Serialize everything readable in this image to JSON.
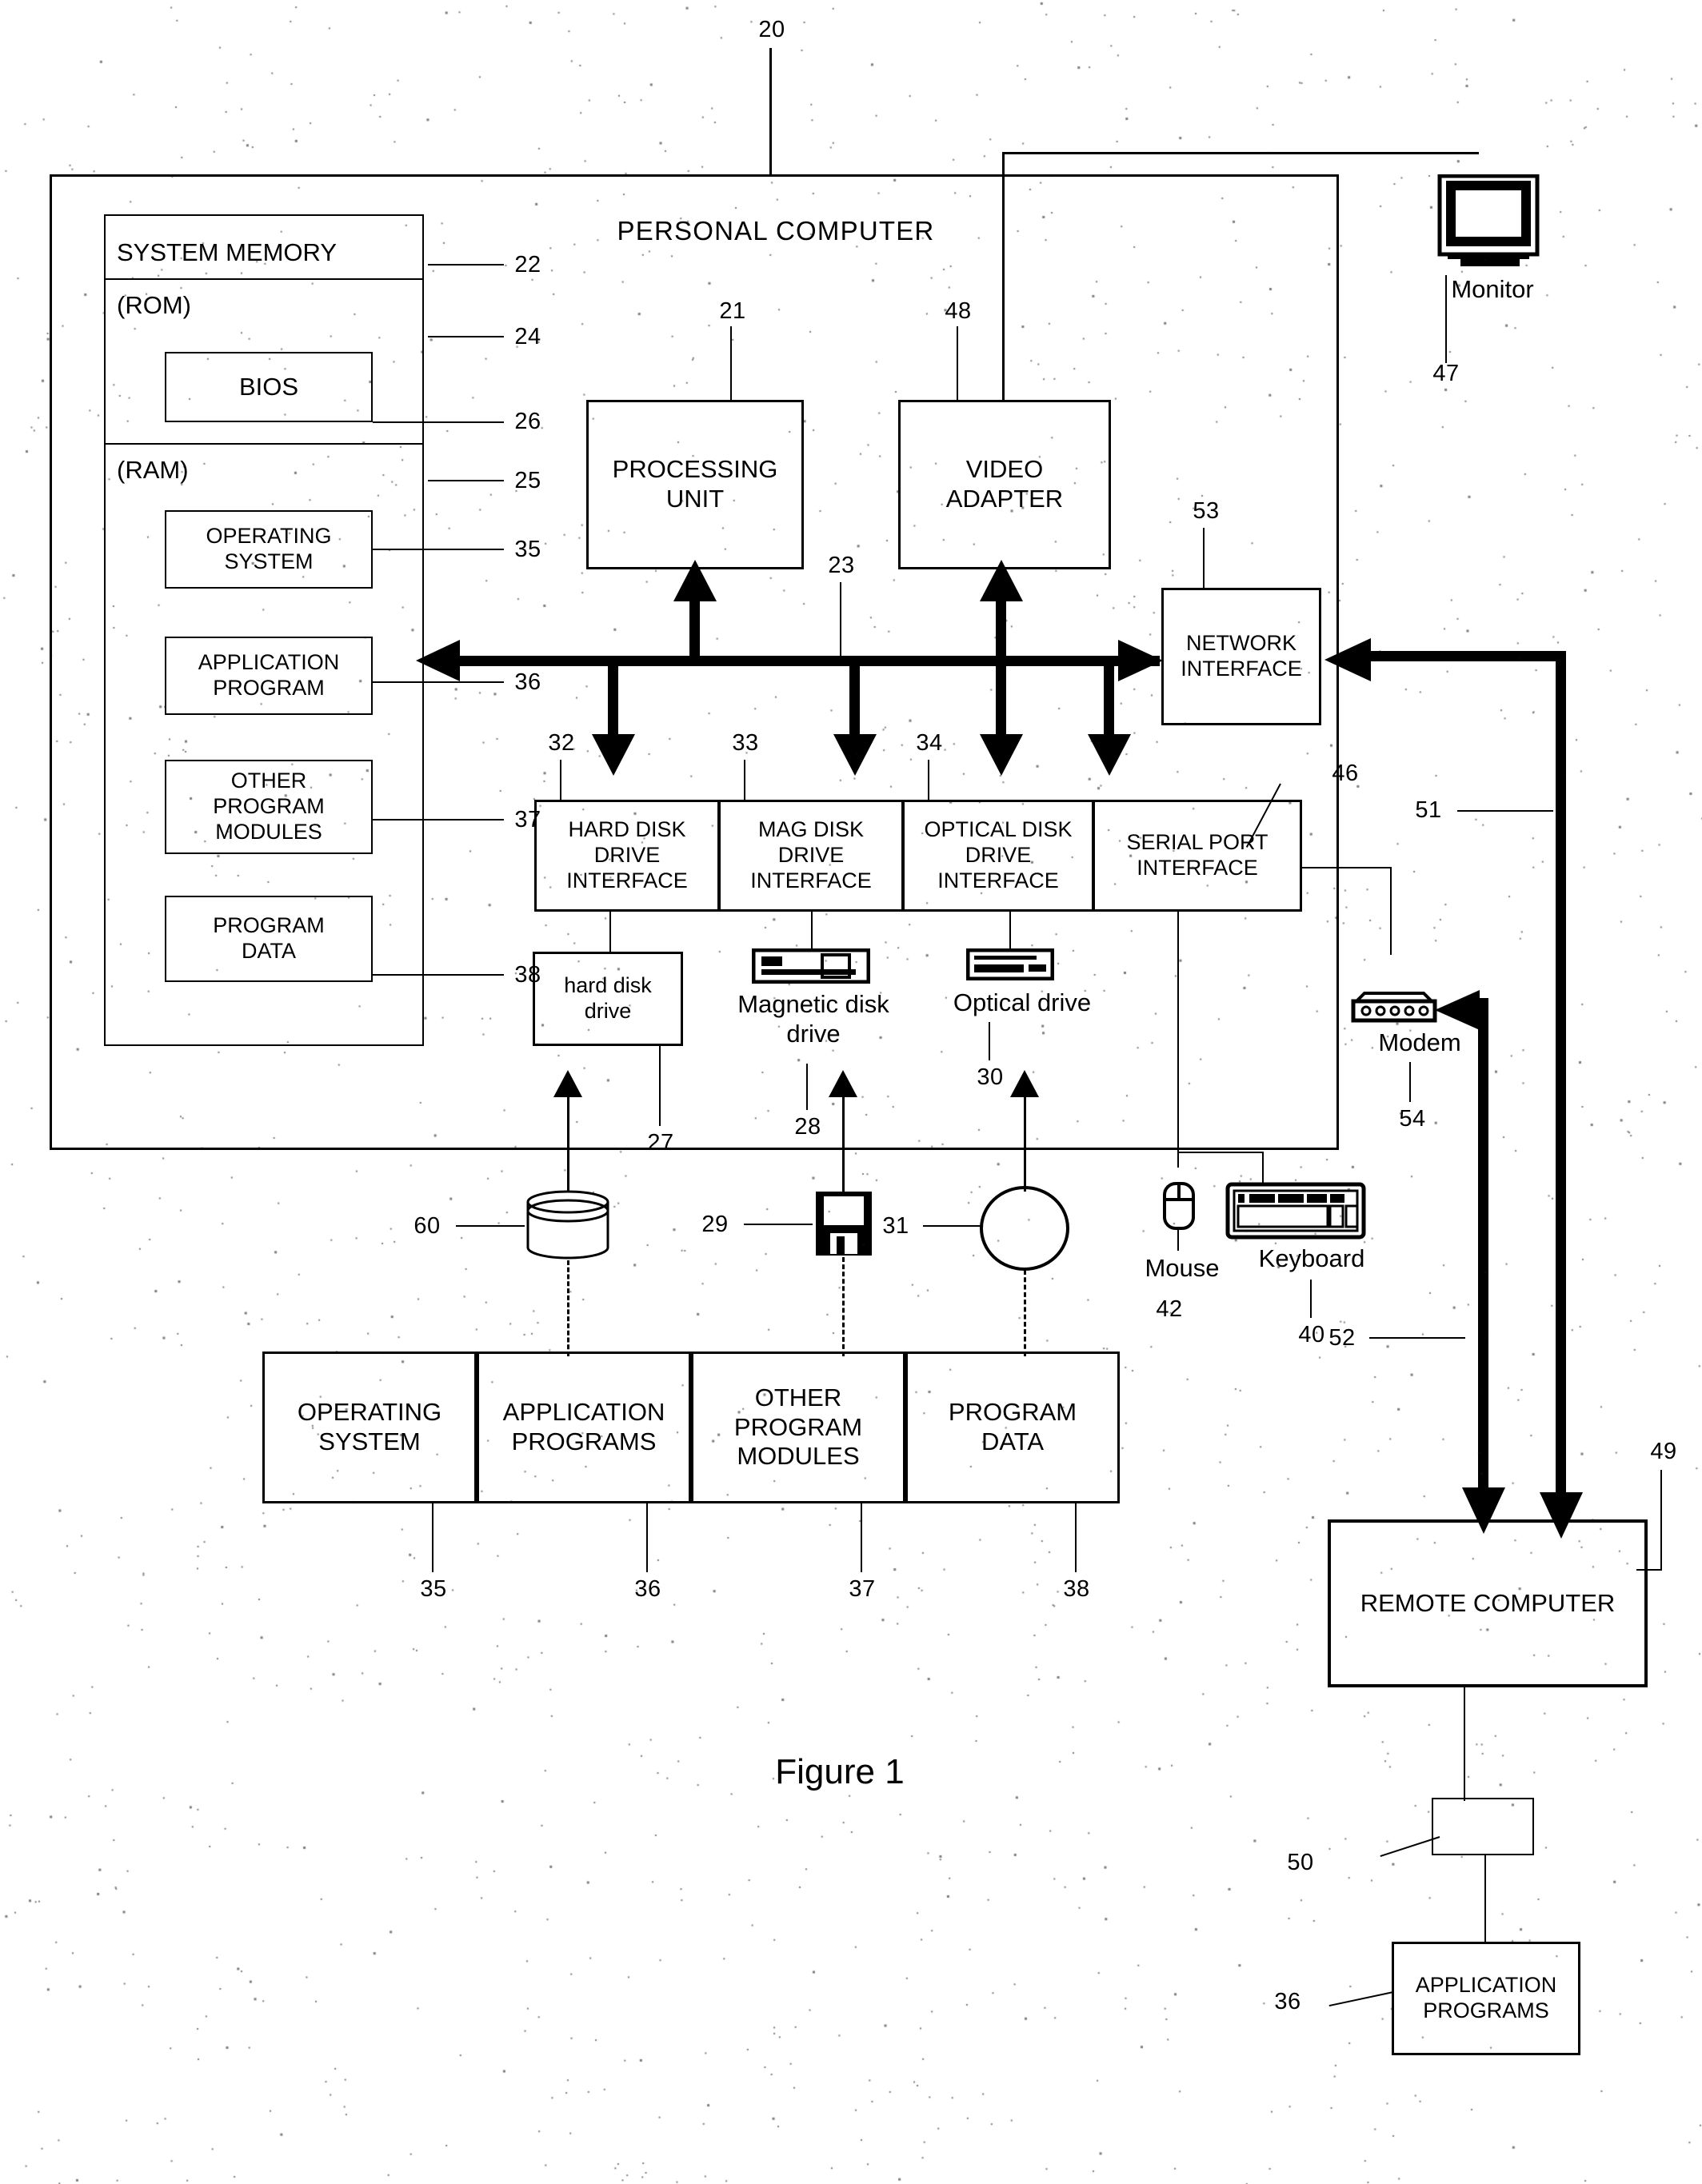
{
  "figure": {
    "caption": "Figure 1",
    "top_reference": "20",
    "system_title": "PERSONAL COMPUTER"
  },
  "system_memory": {
    "title": "SYSTEM MEMORY",
    "ref": "22",
    "rom": {
      "label": "(ROM)",
      "ref": "24",
      "bios": {
        "label": "BIOS",
        "ref": "26"
      }
    },
    "ram": {
      "label": "(RAM)",
      "ref": "25",
      "blocks": [
        {
          "label": "OPERATING\nSYSTEM",
          "ref": "35"
        },
        {
          "label": "APPLICATION\nPROGRAM",
          "ref": "36"
        },
        {
          "label": "OTHER\nPROGRAM\nMODULES",
          "ref": "37"
        },
        {
          "label": "PROGRAM\nDATA",
          "ref": "38"
        }
      ]
    }
  },
  "core": {
    "processing_unit": {
      "label": "PROCESSING\nUNIT",
      "ref": "21"
    },
    "video_adapter": {
      "label": "VIDEO\nADAPTER",
      "ref": "48"
    },
    "network_interface": {
      "label": "NETWORK\nINTERFACE",
      "ref": "53"
    },
    "bus": {
      "ref": "23"
    }
  },
  "interfaces": [
    {
      "label": "HARD DISK\nDRIVE\nINTERFACE",
      "ref": "32"
    },
    {
      "label": "MAG DISK\nDRIVE\nINTERFACE",
      "ref": "33"
    },
    {
      "label": "OPTICAL DISK\nDRIVE\nINTERFACE",
      "ref": "34"
    },
    {
      "label": "SERIAL PORT\nINTERFACE",
      "ref": "46"
    }
  ],
  "drives": {
    "hard_disk_drive": {
      "label": "hard disk\ndrive",
      "ref": "27"
    },
    "magnetic_disk_drive": {
      "label": "Magnetic disk\ndrive",
      "ref": "28"
    },
    "optical_drive": {
      "label": "Optical drive",
      "ref": "30"
    }
  },
  "media": {
    "hard_disk_platter_ref": "60",
    "floppy_disk_ref": "29",
    "optical_disc_ref": "31"
  },
  "peripherals": {
    "monitor": {
      "label": "Monitor",
      "ref": "47"
    },
    "mouse": {
      "label": "Mouse",
      "ref": "42"
    },
    "keyboard": {
      "label": "Keyboard",
      "ref": "40"
    },
    "modem": {
      "label": "Modem",
      "ref": "54"
    }
  },
  "storage_contents": [
    {
      "label": "OPERATING\nSYSTEM",
      "ref": "35"
    },
    {
      "label": "APPLICATION\nPROGRAMS",
      "ref": "36"
    },
    {
      "label": "OTHER\nPROGRAM\nMODULES",
      "ref": "37"
    },
    {
      "label": "PROGRAM\nDATA",
      "ref": "38"
    }
  ],
  "network": {
    "remote_computer": {
      "label": "REMOTE COMPUTER",
      "ref": "49"
    },
    "wan_link_ref": "51",
    "lan_link_ref": "52",
    "remote_storage_ref": "50",
    "remote_application_programs": {
      "label": "APPLICATION\nPROGRAMS",
      "ref": "36"
    }
  }
}
